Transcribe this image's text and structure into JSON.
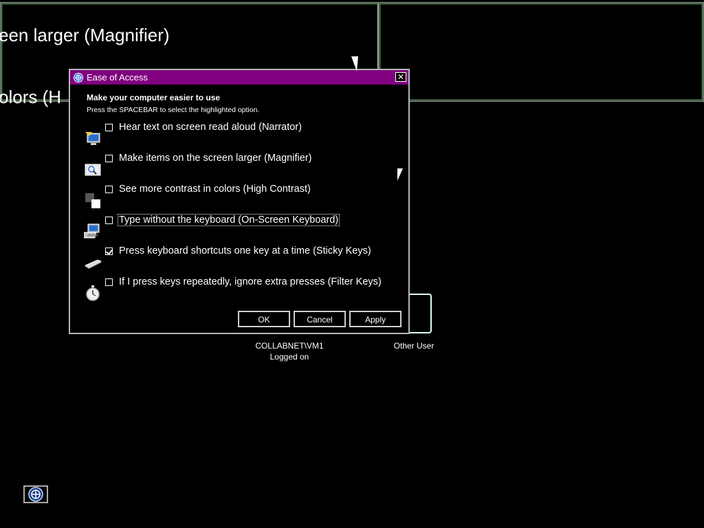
{
  "background": {
    "text_line_1": "een larger (Magnifier)",
    "text_line_2": "olors (H",
    "users": [
      {
        "name": "COLLABNET\\VM1",
        "status": "Logged on"
      },
      {
        "name": "Other User"
      }
    ]
  },
  "dialog": {
    "title": "Ease of Access",
    "close_label": "✕",
    "heading": "Make your computer easier to use",
    "instruction": "Press the SPACEBAR to select the highlighted option.",
    "options": [
      {
        "label": "Hear text on screen read aloud (Narrator)",
        "checked": false,
        "icon": "narrator-icon"
      },
      {
        "label": "Make items on the screen larger (Magnifier)",
        "checked": false,
        "icon": "magnifier-icon"
      },
      {
        "label": "See more contrast in colors (High Contrast)",
        "checked": false,
        "icon": "high-contrast-icon"
      },
      {
        "label": "Type without the keyboard (On-Screen Keyboard)",
        "checked": false,
        "focused": true,
        "icon": "on-screen-keyboard-icon"
      },
      {
        "label": "Press keyboard shortcuts one key at a time (Sticky Keys)",
        "checked": true,
        "icon": "sticky-keys-icon"
      },
      {
        "label": "If I press keys repeatedly, ignore extra presses (Filter Keys)",
        "checked": false,
        "icon": "filter-keys-icon"
      }
    ],
    "buttons": {
      "ok": "OK",
      "cancel": "Cancel",
      "apply": "Apply"
    }
  },
  "colors": {
    "titlebar": "#800080",
    "panel_border": "#9ec89e"
  }
}
